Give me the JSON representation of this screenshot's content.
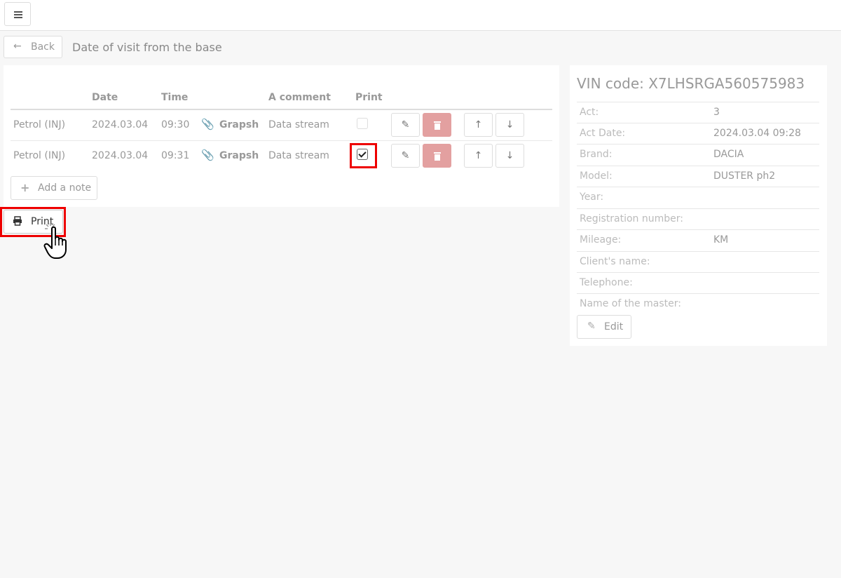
{
  "page": {
    "back_label": "Back",
    "title": "Date of visit from the base"
  },
  "table": {
    "headers": {
      "date": "Date",
      "time": "Time",
      "comment": "A comment",
      "print": "Print"
    },
    "rows": [
      {
        "type": "Petrol (INJ)",
        "date": "2024.03.04",
        "time": "09:30",
        "attachment": "Grapsh",
        "comment": "Data stream",
        "print_checked": false
      },
      {
        "type": "Petrol (INJ)",
        "date": "2024.03.04",
        "time": "09:31",
        "attachment": "Grapsh",
        "comment": "Data stream",
        "print_checked": true
      }
    ]
  },
  "actions": {
    "add_note_label": "Add a note",
    "print_label": "Print"
  },
  "vehicle": {
    "vin_heading": "VIN code: X7LHSRGA560575983",
    "fields": [
      {
        "label": "Act:",
        "value": "3"
      },
      {
        "label": "Act Date:",
        "value": "2024.03.04 09:28"
      },
      {
        "label": "Brand:",
        "value": "DACIA"
      },
      {
        "label": "Model:",
        "value": "DUSTER ph2"
      },
      {
        "label": "Year:",
        "value": ""
      },
      {
        "label": "Registration number:",
        "value": ""
      },
      {
        "label": "Mileage:",
        "value": "KM"
      },
      {
        "label": "Client's name:",
        "value": ""
      },
      {
        "label": "Telephone:",
        "value": ""
      },
      {
        "label": "Name of the master:",
        "value": ""
      }
    ],
    "edit_label": "Edit"
  },
  "icons": {
    "menu": "hamburger-icon",
    "back": "arrow-left-icon",
    "attachment": "paperclip-icon",
    "edit": "pencil-icon",
    "delete": "trash-icon",
    "move_up": "arrow-up-icon",
    "move_down": "arrow-down-icon",
    "add": "plus-icon",
    "print": "printer-icon",
    "cursor": "hand-pointer-icon"
  },
  "colors": {
    "background": "#f7f7f7",
    "panel": "#ffffff",
    "danger_button": "#e3a0a0",
    "highlight": "#ee0000"
  }
}
